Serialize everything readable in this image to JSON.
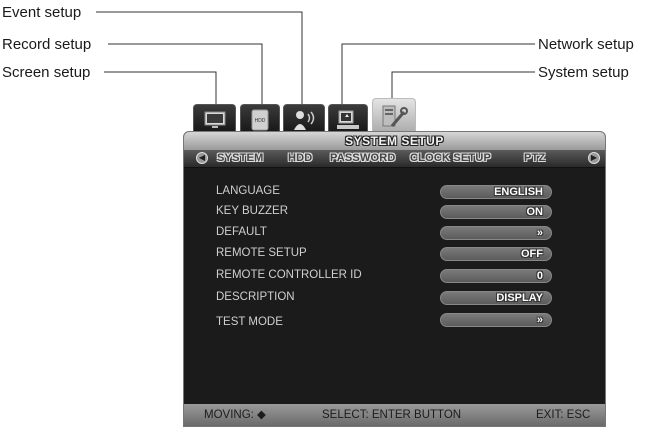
{
  "callouts": {
    "event": "Event setup",
    "record": "Record setup",
    "screen": "Screen setup",
    "network": "Network setup",
    "system": "System setup"
  },
  "tabs": [
    {
      "name": "screen",
      "icon": "monitor-icon"
    },
    {
      "name": "record",
      "icon": "hdd-icon",
      "text": "HDD"
    },
    {
      "name": "event",
      "icon": "person-sensor-icon"
    },
    {
      "name": "network",
      "icon": "network-computer-icon"
    },
    {
      "name": "system",
      "icon": "tools-icon",
      "active": true
    }
  ],
  "panel": {
    "title": "SYSTEM SETUP",
    "menu": [
      "SYSTEM",
      "HDD",
      "PASSWORD",
      "CLOCK SETUP",
      "PTZ"
    ],
    "rows": [
      {
        "label": "LANGUAGE",
        "value": "ENGLISH"
      },
      {
        "label": "KEY BUZZER",
        "value": "ON"
      },
      {
        "label": "DEFAULT",
        "value": "»"
      },
      {
        "label": "REMOTE SETUP",
        "value": "OFF"
      },
      {
        "label": "REMOTE CONTROLLER ID",
        "value": "0"
      },
      {
        "label": "DESCRIPTION",
        "value": "DISPLAY"
      },
      {
        "label": "TEST MODE",
        "value": "»"
      }
    ],
    "status": {
      "moving": "MOVING: ◆",
      "select": "SELECT: ENTER BUTTON",
      "exit": "EXIT: ESC"
    }
  }
}
